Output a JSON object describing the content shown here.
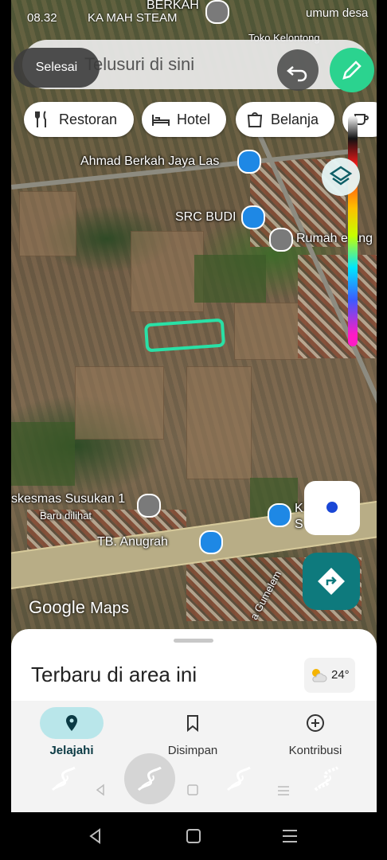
{
  "status_bar": {
    "time": "08.32",
    "notif_text": "KA MAH STEAM",
    "right_text": "umum desa"
  },
  "search": {
    "placeholder": "Telusuri di sini",
    "done_label": "Selesai"
  },
  "chips": [
    {
      "label": "Restoran",
      "icon": "fork-knife-icon"
    },
    {
      "label": "Hotel",
      "icon": "bed-icon"
    },
    {
      "label": "Belanja",
      "icon": "shopping-bag-icon"
    }
  ],
  "places": {
    "berkah": "BERKAH",
    "toko": "Toko Kelontong",
    "ahmad": "Ahmad Berkah Jaya Las",
    "src": "SRC BUDI",
    "rumah": "Rumah e ang",
    "puskesmas": "skesmas Susukan 1",
    "baru": "Baru dilihat",
    "tb": "TB. Anugrah",
    "k_ot": "K OT",
    "s": "S",
    "jalan": "a Gumelem"
  },
  "attribution": {
    "google": "Google",
    "maps": "Maps"
  },
  "sheet": {
    "title": "Terbaru di area ini",
    "weather": "24°"
  },
  "nav": {
    "items": [
      {
        "label": "Jelajahi",
        "icon": "location-pin-icon",
        "active": true
      },
      {
        "label": "Disimpan",
        "icon": "bookmark-icon",
        "active": false
      },
      {
        "label": "Kontribusi",
        "icon": "add-circle-icon",
        "active": false
      }
    ]
  },
  "colors": {
    "accent_green": "#2bd38f",
    "highlight_stroke": "#29e0a6",
    "directions_button": "#0e7a7d",
    "nav_active_pill": "#b9e6ea",
    "pin_blue": "#1e88e5"
  }
}
